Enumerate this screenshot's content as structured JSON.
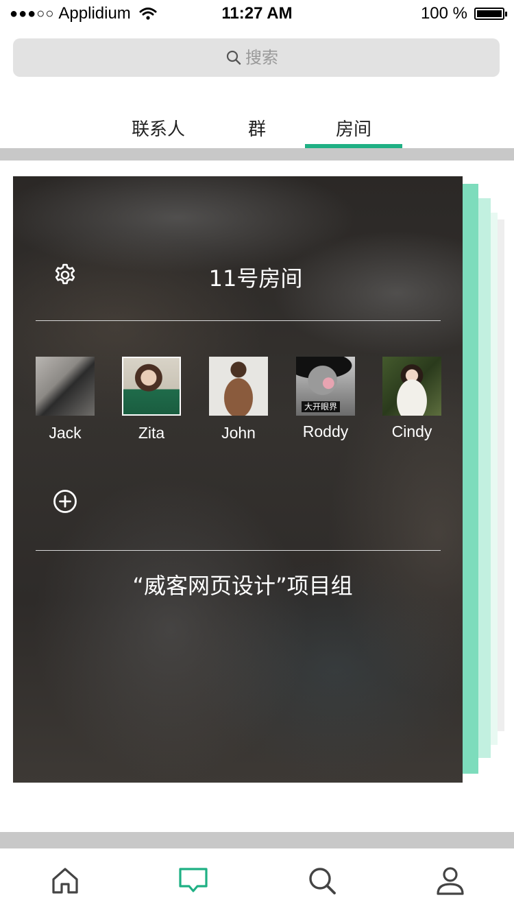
{
  "status_bar": {
    "carrier_dots": "●●●○○",
    "carrier": "Applidium",
    "time": "11:27 AM",
    "battery": "100 %"
  },
  "search": {
    "placeholder": "搜索",
    "icon": "search-icon"
  },
  "tabs": [
    {
      "label": "联系人",
      "active": false
    },
    {
      "label": "群",
      "active": false
    },
    {
      "label": "房间",
      "active": true
    }
  ],
  "accent_color": "#1fb084",
  "room": {
    "title": "11号房间",
    "members": [
      {
        "name": "Jack"
      },
      {
        "name": "Zita"
      },
      {
        "name": "John"
      },
      {
        "name": "Roddy",
        "avatar_caption": "大开眼界"
      },
      {
        "name": "Cindy"
      }
    ],
    "description": "“威客网页设计”项目组",
    "settings_icon": "gear-icon",
    "add_icon": "add-circle-icon"
  },
  "bottom_nav": [
    {
      "icon": "home-icon",
      "active": false
    },
    {
      "icon": "message-icon",
      "active": true
    },
    {
      "icon": "search-icon",
      "active": false
    },
    {
      "icon": "user-icon",
      "active": false
    }
  ]
}
